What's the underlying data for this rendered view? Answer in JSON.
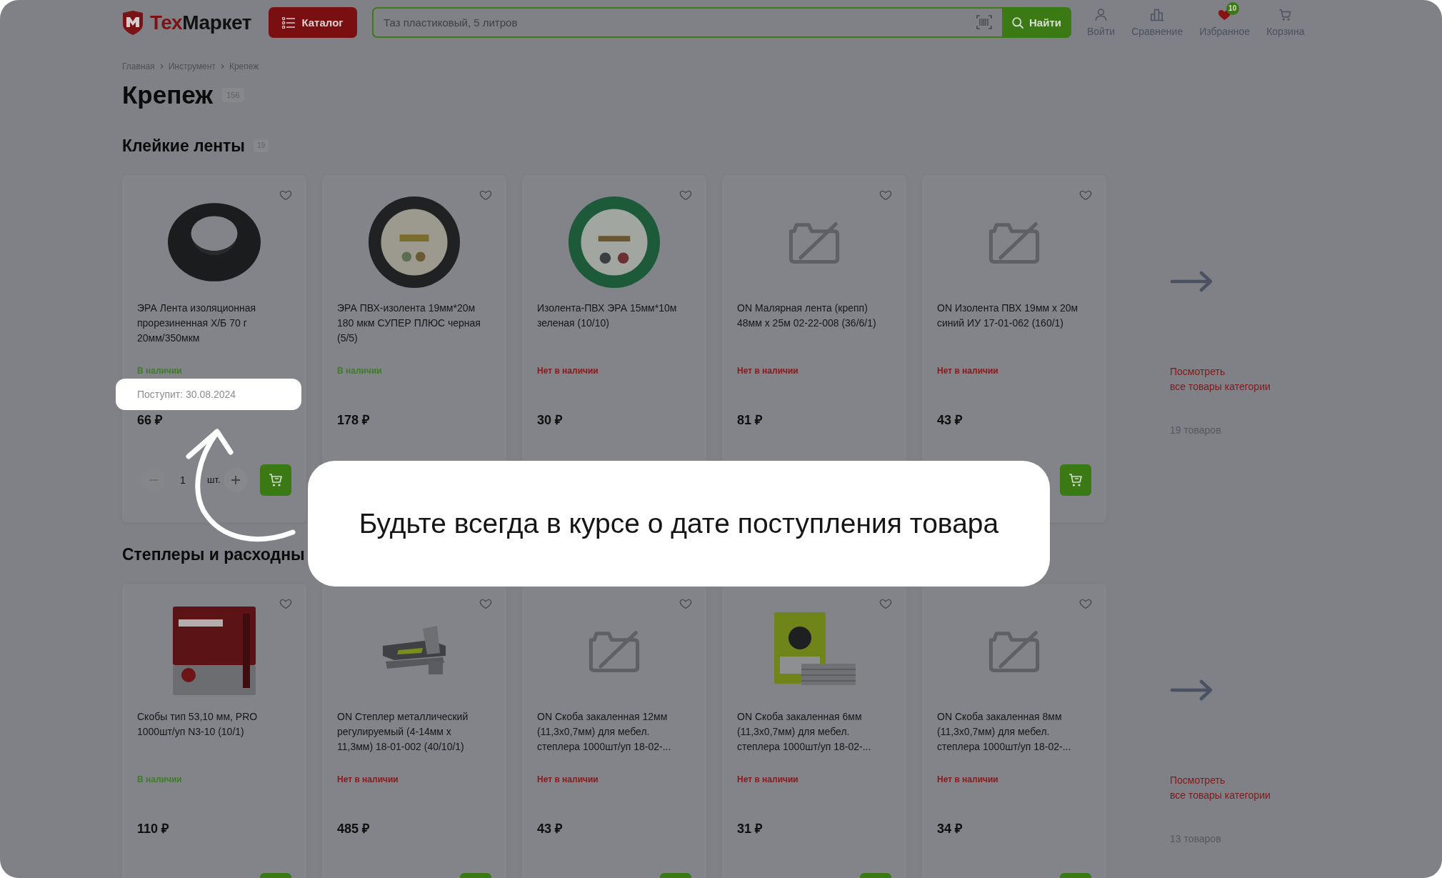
{
  "header": {
    "logo": {
      "accent": "Тех",
      "rest": "Маркет"
    },
    "catalog_button": "Каталог",
    "search": {
      "placeholder": "Таз пластиковый, 5 литров",
      "button": "Найти"
    },
    "nav": [
      {
        "kind": "login",
        "label": "Войти"
      },
      {
        "kind": "compare",
        "label": "Сравнение"
      },
      {
        "kind": "favorites",
        "label": "Избранное",
        "badge": "10"
      },
      {
        "kind": "cart",
        "label": "Корзина"
      }
    ]
  },
  "breadcrumbs": [
    "Главная",
    "Инструмент",
    "Крепеж"
  ],
  "page_title": {
    "text": "Крепеж",
    "count": "156"
  },
  "sections": [
    {
      "title": "Клейкие ленты",
      "count": "19",
      "cards": [
        {
          "image": {
            "kind": "cloth-tape"
          },
          "name": "ЭРА Лента изоляционная прорезиненная Х/Б 70 г 20мм/350мкм",
          "in_stock": true,
          "stock": "В наличии",
          "price": "66 ₽",
          "favorite": false,
          "quantity": {
            "value": "1",
            "unit": "шт.",
            "minus_disabled": true
          },
          "cart_button": true
        },
        {
          "image": {
            "kind": "black-tape"
          },
          "name": "ЭРА ПВХ-изолента 19мм*20м 180 мкм СУПЕР ПЛЮС черная (5/5)",
          "in_stock": true,
          "stock": "В наличии",
          "price": "178 ₽",
          "favorite": false,
          "cart_button": false
        },
        {
          "image": {
            "kind": "green-tape"
          },
          "name": "Изолента-ПВХ ЭРА 15мм*10м зеленая (10/10)",
          "in_stock": false,
          "stock": "Нет в наличии",
          "price": "30 ₽",
          "favorite": false,
          "cart_button": false
        },
        {
          "image": {
            "kind": "no-photo"
          },
          "name": "ON Малярная лента (крепп) 48мм х 25м 02-22-008 (36/6/1)",
          "in_stock": false,
          "stock": "Нет в наличии",
          "price": "81 ₽",
          "favorite": false,
          "cart_button": false
        },
        {
          "image": {
            "kind": "no-photo"
          },
          "name": "ON Изолента ПВХ 19мм х 20м синий ИУ 17-01-062 (160/1)",
          "in_stock": false,
          "stock": "Нет в наличии",
          "price": "43 ₽",
          "favorite": false,
          "cart_button": true
        }
      ],
      "more": {
        "link": [
          "Посмотреть",
          "все товары категории"
        ],
        "count": "19 товаров"
      }
    },
    {
      "title": "Степлеры и расходны",
      "cards": [
        {
          "image": {
            "kind": "red-box"
          },
          "name": "Скобы тип 53,10 мм, PRO 1000шт/уп N3-10 (10/1)",
          "in_stock": true,
          "stock": "В наличии",
          "price": "110 ₽",
          "favorite": false,
          "cart_button": true
        },
        {
          "image": {
            "kind": "stapler"
          },
          "name": "ON Степлер металлический регулируемый (4-14мм х 11,3мм) 18-01-002 (40/10/1)",
          "in_stock": false,
          "stock": "Нет в наличии",
          "price": "485 ₽",
          "favorite": false,
          "cart_button": true
        },
        {
          "image": {
            "kind": "no-photo"
          },
          "name": "ON Скоба закаленная 12мм (11,3х0,7мм) для мебел. степлера 1000шт/уп 18-02-...",
          "in_stock": false,
          "stock": "Нет в наличии",
          "price": "43 ₽",
          "favorite": false,
          "cart_button": true
        },
        {
          "image": {
            "kind": "green-box"
          },
          "name": "ON Скоба закаленная 6мм (11,3х0,7мм) для мебел. степлера 1000шт/уп 18-02-...",
          "in_stock": false,
          "stock": "Нет в наличии",
          "price": "31 ₽",
          "favorite": false,
          "cart_button": true
        },
        {
          "image": {
            "kind": "no-photo"
          },
          "name": "ON Скоба закаленная 8мм (11,3х0,7мм) для мебел. степлера 1000шт/уп 18-02-...",
          "in_stock": false,
          "stock": "Нет в наличии",
          "price": "34 ₽",
          "favorite": false,
          "cart_button": true
        }
      ],
      "more": {
        "link": [
          "Посмотреть",
          "все товары категории"
        ],
        "count": "13 товаров"
      }
    }
  ],
  "tooltip": "Поступит: 30.08.2024",
  "callout": "Будьте всегда в курсе о дате поступления товара"
}
